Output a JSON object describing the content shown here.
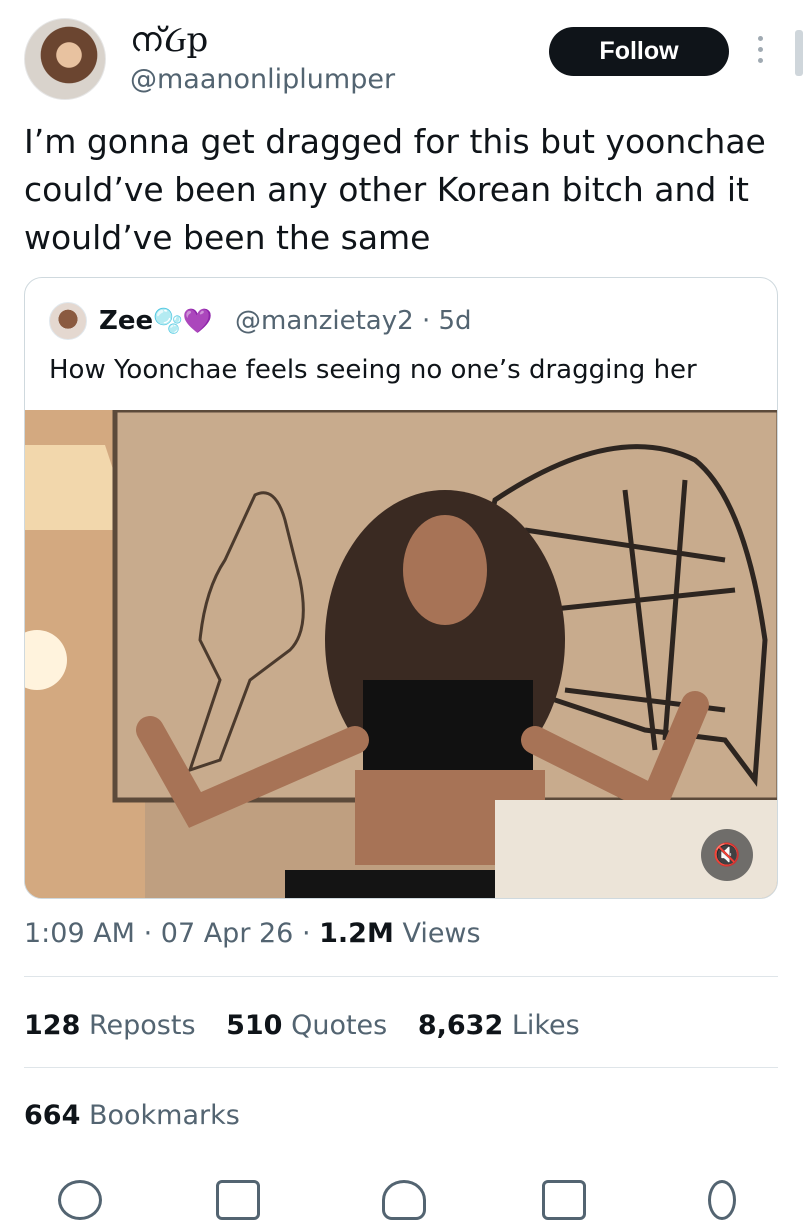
{
  "author": {
    "display_name": "ന്Ᏽp",
    "handle": "@maanonliplumper"
  },
  "follow_button": "Follow",
  "tweet_text": "I’m gonna get dragged for this but yoonchae could’ve been any other Korean bitch and it would’ve been the same",
  "quote": {
    "name": "Zee",
    "emoji": "🫧💜",
    "handle": "@manzietay2",
    "separator": "·",
    "age": "5d",
    "text": "How Yoonchae feels seeing no one’s dragging her",
    "media_icon": "mute-icon",
    "mute_glyph": "🔇"
  },
  "meta": {
    "time": "1:09 AM",
    "sep1": "·",
    "date": "07 Apr 26",
    "sep2": "·",
    "views_count": "1.2M",
    "views_label": "Views"
  },
  "stats": {
    "reposts_count": "128",
    "reposts_label": "Reposts",
    "quotes_count": "510",
    "quotes_label": "Quotes",
    "likes_count": "8,632",
    "likes_label": "Likes",
    "bookmarks_count": "664",
    "bookmarks_label": "Bookmarks"
  },
  "colors": {
    "text_primary": "#0f1419",
    "text_secondary": "#536471",
    "border": "#cfd9de"
  }
}
